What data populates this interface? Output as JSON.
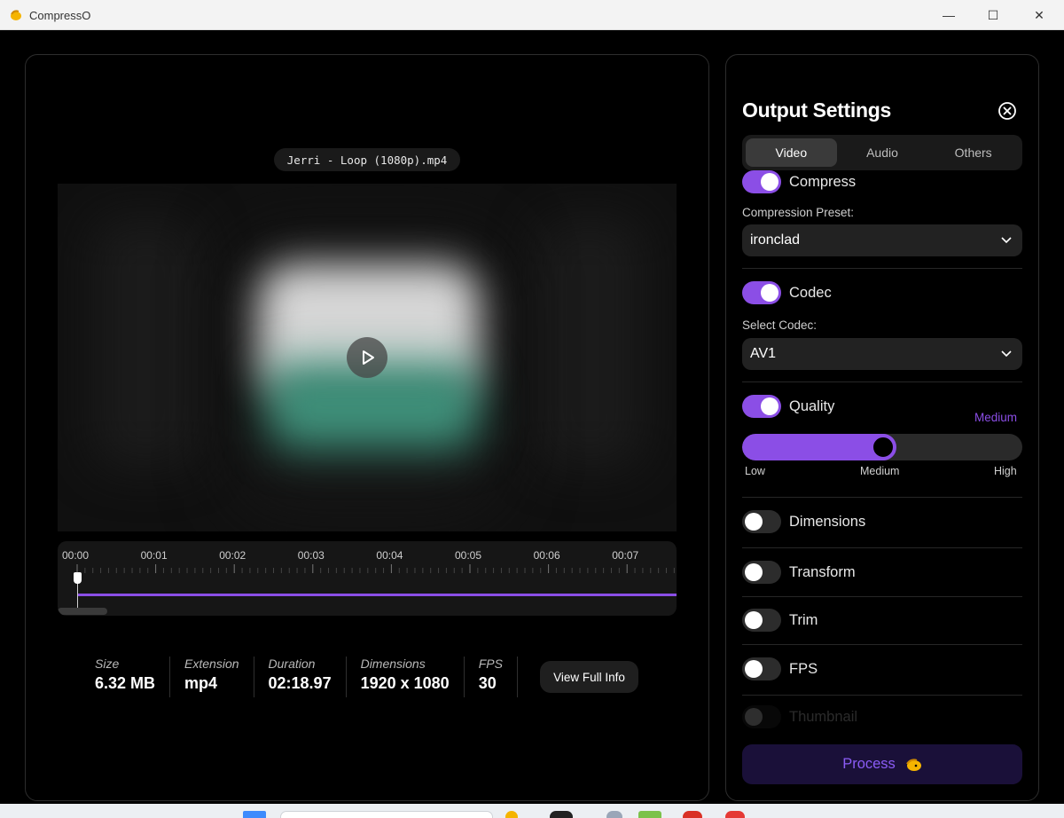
{
  "window": {
    "title": "CompressO",
    "minimize_glyph": "—",
    "maximize_glyph": "☐",
    "close_glyph": "✕"
  },
  "preview": {
    "file_name": "Jerri - Loop (1080p).mp4",
    "timeline_ticks": [
      "00:00",
      "00:01",
      "00:02",
      "00:03",
      "00:04",
      "00:05",
      "00:06",
      "00:07"
    ],
    "playhead_fraction": 0.0
  },
  "info": {
    "size_label": "Size",
    "size_value": "6.32 MB",
    "extension_label": "Extension",
    "extension_value": "mp4",
    "duration_label": "Duration",
    "duration_value": "02:18.97",
    "dimensions_label": "Dimensions",
    "dimensions_value": "1920 x 1080",
    "fps_label": "FPS",
    "fps_value": "30",
    "view_full_info_label": "View Full Info"
  },
  "settings": {
    "title": "Output Settings",
    "tabs": [
      {
        "label": "Video",
        "active": true
      },
      {
        "label": "Audio",
        "active": false
      },
      {
        "label": "Others",
        "active": false
      }
    ],
    "compress": {
      "label": "Compress",
      "enabled": true,
      "preset_label": "Compression Preset:",
      "preset_value": "ironclad"
    },
    "codec": {
      "label": "Codec",
      "enabled": true,
      "select_label": "Select Codec:",
      "select_value": "AV1"
    },
    "quality": {
      "label": "Quality",
      "enabled": true,
      "current": "Medium",
      "level_fraction": 0.5,
      "min_label": "Low",
      "mid_label": "Medium",
      "max_label": "High"
    },
    "dimensions": {
      "label": "Dimensions",
      "enabled": false
    },
    "transform": {
      "label": "Transform",
      "enabled": false
    },
    "trim": {
      "label": "Trim",
      "enabled": false
    },
    "fps": {
      "label": "FPS",
      "enabled": false
    },
    "thumbnail": {
      "label": "Thumbnail",
      "enabled": false
    },
    "process_label": "Process"
  },
  "colors": {
    "accent": "#8b4ee6",
    "panel_border": "#2d2d2d",
    "surface": "#222222",
    "process_bg": "#1a1039"
  }
}
